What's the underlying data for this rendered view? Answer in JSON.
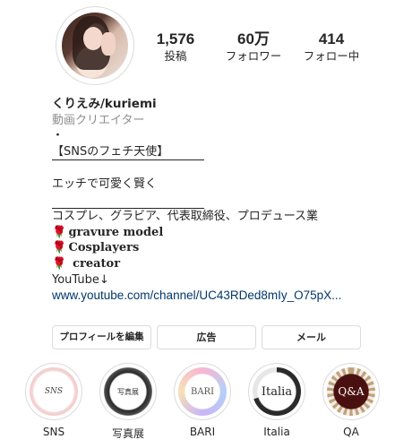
{
  "profile": {
    "stats": [
      {
        "value": "1,576",
        "label": "投稿"
      },
      {
        "value": "60万",
        "label": "フォロワー"
      },
      {
        "value": "414",
        "label": "フォロー中"
      }
    ],
    "name": "くりえみ/kuriemi",
    "category": "動画クリエイター",
    "bio": {
      "dot": "・",
      "tagline": "【SNSのフェチ天使】",
      "underline_1": "",
      "motto": "エッチで可愛く賢く",
      "underline_2": "",
      "roles": "コスプレ、グラビア、代表取締役、プロデュース業",
      "rose_icon": "rose-icon",
      "item_1": "gravure model",
      "item_2": "Cosplayers",
      "item_3": "creator",
      "youtube": "YouTube↓",
      "link": "www.youtube.com/channel/UC43RDed8mIy_O75pX..."
    }
  },
  "buttons": {
    "edit_profile": "プロフィールを編集",
    "ads": "広告",
    "mail": "メール"
  },
  "highlights": [
    {
      "cover": "SNS",
      "label": "SNS"
    },
    {
      "cover": "写真展",
      "label": "写真展"
    },
    {
      "cover": "BARI",
      "label": "BARI"
    },
    {
      "cover": "Italia",
      "label": "Italia"
    },
    {
      "cover": "Q&A",
      "label": "QA"
    }
  ],
  "colors": {
    "link": "#00376b",
    "muted": "#8e8e8e",
    "border": "#dbdbdb",
    "rose": "#c0182a"
  }
}
